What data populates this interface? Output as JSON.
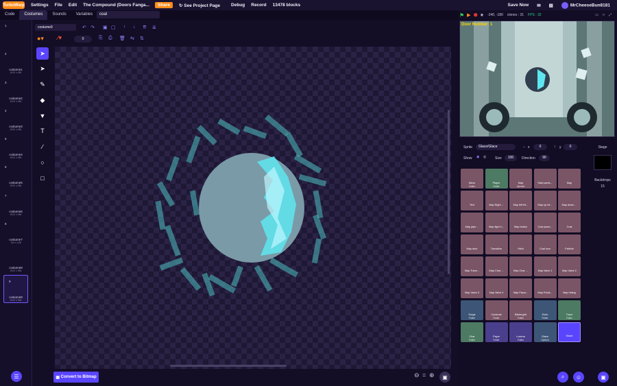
{
  "menu": {
    "logo": "TurboWarp",
    "settings": "Settings",
    "file": "File",
    "edit": "Edit",
    "project_title": "The Compound (Doors Fanga...",
    "share": "Share",
    "see_project": "See Project Page",
    "debug": "Debug",
    "record": "Record",
    "blocks": "13478 blocks",
    "save_now": "Save Now",
    "username": "MrCheeseBun8181"
  },
  "tabs": {
    "code": "Code",
    "costumes": "Costumes",
    "sounds": "Sounds",
    "variables": "Variables"
  },
  "search_value": "coal",
  "costumes": [
    {
      "num": "1",
      "name": "",
      "size": ""
    },
    {
      "num": "2",
      "name": "costume1",
      "size": "1022 x 981"
    },
    {
      "num": "3",
      "name": "costume2",
      "size": "1022 x 981"
    },
    {
      "num": "4",
      "name": "costume3",
      "size": "1022 x 981"
    },
    {
      "num": "5",
      "name": "costume4",
      "size": "1022 x 981"
    },
    {
      "num": "6",
      "name": "costume5",
      "size": "1022 x 981"
    },
    {
      "num": "7",
      "name": "costume6",
      "size": "1022 x 981"
    },
    {
      "num": "8",
      "name": "costume7",
      "size": "134 x 136"
    },
    {
      "num": "",
      "name": "costume8",
      "size": "1022 x 981"
    },
    {
      "num": "9",
      "name": "costume9",
      "size": "1022 x 981"
    }
  ],
  "editor": {
    "costume_name": "costume9",
    "outline_width": "0",
    "convert_button": "Convert to Bitmap"
  },
  "stage_bar": {
    "coords": "-240, -180",
    "clones": "clones : 31",
    "fps": "FPS : 32"
  },
  "stage": {
    "door_number": "Door Number: 1"
  },
  "sprite_info": {
    "sprite_label": "Sprite",
    "sprite_name": "Glace/Glace",
    "x_label": "x",
    "x_value": "0",
    "y_label": "y",
    "y_value": "0",
    "show_label": "Show",
    "size_label": "Size",
    "size_value": "100",
    "direction_label": "Direction",
    "direction_value": "90"
  },
  "stage_col": {
    "title": "Stage",
    "backdrops_label": "Backdrops",
    "backdrops_count": "15"
  },
  "sprites": [
    {
      "label": "Menu",
      "sub": "Folder",
      "style": ""
    },
    {
      "label": "Player",
      "sub": "Folder",
      "style": "green"
    },
    {
      "label": "Map",
      "sub": "Opened",
      "style": ""
    },
    {
      "label": "Start partic...",
      "sub": "",
      "style": ""
    },
    {
      "label": "Map",
      "sub": "",
      "style": ""
    },
    {
      "label": "Text",
      "sub": "",
      "style": ""
    },
    {
      "label": "Map Right ...",
      "sub": "",
      "style": ""
    },
    {
      "label": "Map left hit...",
      "sub": "",
      "style": ""
    },
    {
      "label": "Map up hit...",
      "sub": "",
      "style": ""
    },
    {
      "label": "Map down ...",
      "sub": "",
      "style": ""
    },
    {
      "label": "Map pipe ...",
      "sub": "",
      "style": ""
    },
    {
      "label": "Map light h...",
      "sub": "",
      "style": ""
    },
    {
      "label": "Map button",
      "sub": "",
      "style": ""
    },
    {
      "label": "Coal place...",
      "sub": "",
      "style": ""
    },
    {
      "label": "Coal",
      "sub": "",
      "style": ""
    },
    {
      "label": "Map door",
      "sub": "",
      "style": ""
    },
    {
      "label": "Transition",
      "sub": "",
      "style": ""
    },
    {
      "label": "Hitch",
      "sub": "",
      "style": ""
    },
    {
      "label": "Coal icon",
      "sub": "",
      "style": ""
    },
    {
      "label": "Particle",
      "sub": "",
      "style": ""
    },
    {
      "label": "Map Trave...",
      "sub": "",
      "style": ""
    },
    {
      "label": "Map Char ...",
      "sub": "",
      "style": ""
    },
    {
      "label": "Map Char ...",
      "sub": "",
      "style": ""
    },
    {
      "label": "Map Valve 1",
      "sub": "",
      "style": ""
    },
    {
      "label": "Map Valve 2",
      "sub": "",
      "style": ""
    },
    {
      "label": "Map Valve 3",
      "sub": "",
      "style": ""
    },
    {
      "label": "Map Valve 4",
      "sub": "",
      "style": ""
    },
    {
      "label": "Map Pasor...",
      "sub": "",
      "style": ""
    },
    {
      "label": "Map Pools...",
      "sub": "",
      "style": ""
    },
    {
      "label": "Map hiding",
      "sub": "",
      "style": ""
    },
    {
      "label": "Surge",
      "sub": "Folder",
      "style": "slate"
    },
    {
      "label": "Combust",
      "sub": "Folder",
      "style": ""
    },
    {
      "label": "Blistergrid",
      "sub": "Folder",
      "style": ""
    },
    {
      "label": "Echo",
      "sub": "Folder",
      "style": "slate"
    },
    {
      "label": "Trace",
      "sub": "Folder",
      "style": "green"
    },
    {
      "label": "Char",
      "sub": "Folder",
      "style": "green"
    },
    {
      "label": "Payer",
      "sub": "Folder",
      "style": "purple"
    },
    {
      "label": "Lucena",
      "sub": "Folder",
      "style": "purple"
    },
    {
      "label": "Glace",
      "sub": "Opened",
      "style": "slate"
    },
    {
      "label": "Glace",
      "sub": "",
      "style": "sel"
    }
  ]
}
